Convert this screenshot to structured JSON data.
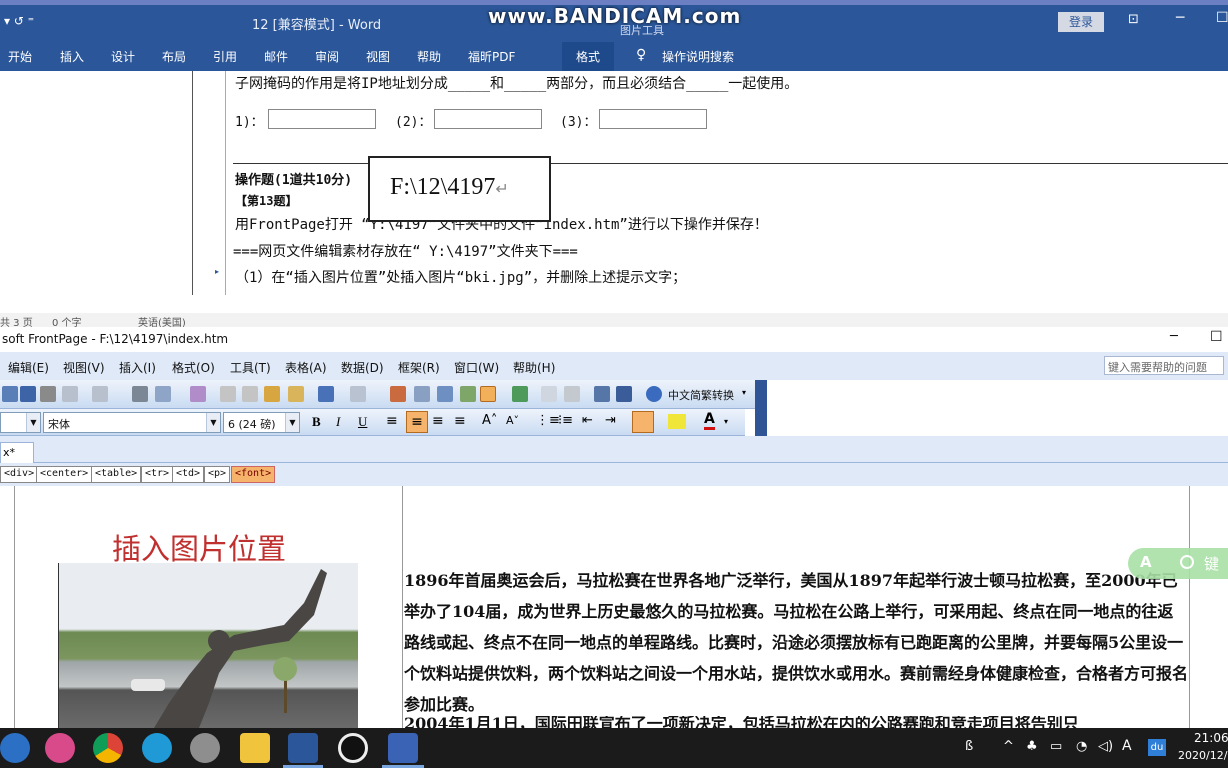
{
  "watermark": "www.BANDICAM.com",
  "word": {
    "title": "12 [兼容模式] - Word",
    "contextual_group": "图片工具",
    "login_label": "登录",
    "ribbon_tabs": [
      "开始",
      "插入",
      "设计",
      "布局",
      "引用",
      "邮件",
      "审阅",
      "视图",
      "帮助",
      "福昕PDF",
      "格式"
    ],
    "tell_me": "操作说明搜索",
    "lines": {
      "subnet": "子网掩码的作用是将IP地址划分成_____和_____两部分，而且必须结合_____一起使用。",
      "blank1": "1)：",
      "blank2": "(2)：",
      "blank3": "(3)：",
      "section": "操作题(1道共10分)",
      "question": "【第13题】",
      "instruction": "用FrontPage打开 “Y:\\4197”文件夹中的文件“index.htm”进行以下操作并保存！",
      "material": "===网页文件编辑素材存放在“ Y:\\4197”文件夹下===",
      "step1": "（1）在“插入图片位置”处插入图片“bki.jpg”，并删除上述提示文字；"
    },
    "popup_path": "F:\\12\\4197",
    "status": {
      "pages": "共 3 页",
      "words": "0 个字",
      "language": "英语(美国)"
    }
  },
  "frontpage": {
    "title": "soft FrontPage - F:\\12\\4197\\index.htm",
    "menus": [
      "编辑(E)",
      "视图(V)",
      "插入(I)",
      "格式(O)",
      "工具(T)",
      "表格(A)",
      "数据(D)",
      "框架(R)",
      "窗口(W)",
      "帮助(H)"
    ],
    "help_placeholder": "键入需要帮助的问题",
    "convert_label": "中文简繁转换",
    "font_name": "宋体",
    "font_size": "6 (24 磅)",
    "tab_label": "x*",
    "quick_tags": [
      "<div>",
      "<center>",
      "<table>",
      "<tr>",
      "<td>",
      "<p>",
      "<font>"
    ],
    "placeholder_text": "插入图片位置",
    "body_text": "1896年首届奥运会后，马拉松赛在世界各地广泛举行，美国从1897年起举行波士顿马拉松赛，至2000年已举办了104届，成为世界上历史最悠久的马拉松赛。马拉松在公路上举行，可采用起、终点在同一地点的往返路线或起、终点不在同一地点的单程路线。比赛时，沿途必须摆放标有已跑距离的公里牌，并要每隔5公里设一个饮料站提供饮料，两个饮料站之间设一个用水站，提供饮水或用水。赛前需经身体健康检查，合格者方可报名参加比赛。",
    "body_text_next": "2004年1月1日，国际田联宣布了一项新决定，包括马拉松在内的公路赛跑和竞走项目将告别只",
    "ime_label": "A",
    "ime_key": "键"
  },
  "taskbar": {
    "time": "21:06",
    "date": "2020/12/",
    "input_indicator": "A",
    "du_label": "du"
  },
  "colors": {
    "word_blue": "#2b579a",
    "fp_blue": "#dfe9f7",
    "placeholder_red": "#c0302f",
    "quick_tag_active": "#f6b36c"
  }
}
